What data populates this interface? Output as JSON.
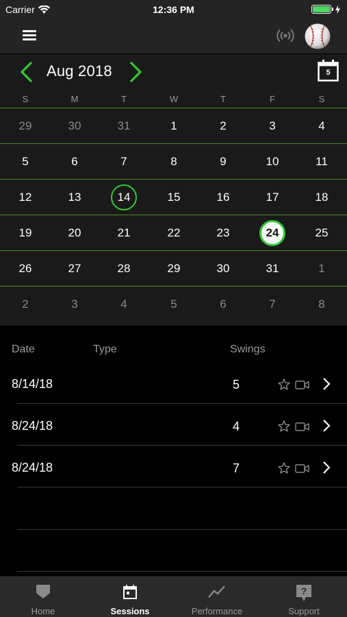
{
  "status_bar": {
    "carrier": "Carrier",
    "time": "12:36 PM"
  },
  "nav": {
    "menu_icon": "hamburger-menu-icon",
    "signal_icon": "broadcast-signal-icon",
    "avatar_icon": "baseball-avatar"
  },
  "calendar": {
    "month_label": "Aug 2018",
    "picker_day": "5",
    "weekdays": [
      "S",
      "M",
      "T",
      "W",
      "T",
      "F",
      "S"
    ],
    "weeks": [
      [
        {
          "d": "29",
          "m": true
        },
        {
          "d": "30",
          "m": true
        },
        {
          "d": "31",
          "m": true
        },
        {
          "d": "1"
        },
        {
          "d": "2"
        },
        {
          "d": "3"
        },
        {
          "d": "4"
        }
      ],
      [
        {
          "d": "5"
        },
        {
          "d": "6"
        },
        {
          "d": "7"
        },
        {
          "d": "8"
        },
        {
          "d": "9"
        },
        {
          "d": "10"
        },
        {
          "d": "11"
        }
      ],
      [
        {
          "d": "12"
        },
        {
          "d": "13"
        },
        {
          "d": "14",
          "session": true
        },
        {
          "d": "15"
        },
        {
          "d": "16"
        },
        {
          "d": "17"
        },
        {
          "d": "18"
        }
      ],
      [
        {
          "d": "19"
        },
        {
          "d": "20"
        },
        {
          "d": "21"
        },
        {
          "d": "22"
        },
        {
          "d": "23"
        },
        {
          "d": "24",
          "session": true,
          "today": true
        },
        {
          "d": "25"
        }
      ],
      [
        {
          "d": "26"
        },
        {
          "d": "27"
        },
        {
          "d": "28"
        },
        {
          "d": "29"
        },
        {
          "d": "30"
        },
        {
          "d": "31"
        },
        {
          "d": "1",
          "m": true
        }
      ],
      [
        {
          "d": "2",
          "m": true
        },
        {
          "d": "3",
          "m": true
        },
        {
          "d": "4",
          "m": true
        },
        {
          "d": "5",
          "m": true
        },
        {
          "d": "6",
          "m": true
        },
        {
          "d": "7",
          "m": true
        },
        {
          "d": "8",
          "m": true
        }
      ]
    ]
  },
  "sessions": {
    "headers": {
      "date": "Date",
      "type": "Type",
      "swings": "Swings"
    },
    "rows": [
      {
        "date": "8/14/18",
        "type": "",
        "swings": "5"
      },
      {
        "date": "8/24/18",
        "type": "",
        "swings": "4"
      },
      {
        "date": "8/24/18",
        "type": "",
        "swings": "7"
      }
    ]
  },
  "tabs": [
    {
      "label": "Home",
      "icon": "home-shield-icon",
      "active": false
    },
    {
      "label": "Sessions",
      "icon": "calendar-icon",
      "active": true
    },
    {
      "label": "Performance",
      "icon": "trend-line-icon",
      "active": false
    },
    {
      "label": "Support",
      "icon": "help-icon",
      "active": false
    }
  ],
  "colors": {
    "accent_green": "#2ecc2e",
    "separator_green": "#4a8a2a",
    "background": "#000000",
    "panel": "#1a1a1a"
  }
}
